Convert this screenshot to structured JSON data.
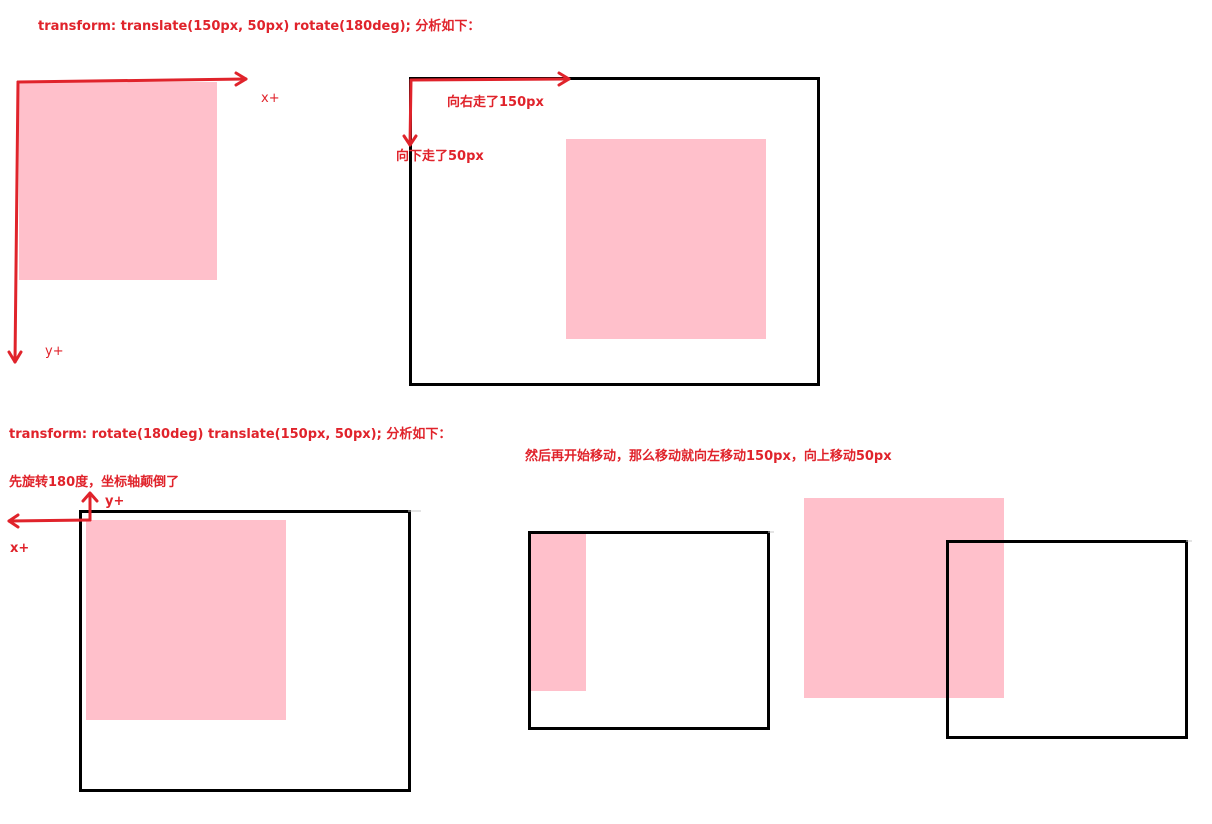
{
  "colors": {
    "annotation": "#e0232b",
    "arrow": "#e0232b",
    "pink_box": "#ffc0cb",
    "frame": "#000000",
    "background": "#ffffff"
  },
  "top_section": {
    "title": "transform: translate(150px, 50px) rotate(180deg); 分析如下：",
    "axes": {
      "x_label": "x+",
      "y_label": "y+"
    },
    "move_right_label": "向右走了150px",
    "move_down_label": "向下走了50px"
  },
  "bottom_section": {
    "title": "transform: rotate(180deg) translate(150px, 50px); 分析如下：",
    "rotate_first_label": "先旋转180度，坐标轴颠倒了",
    "axes": {
      "x_label": "x+",
      "y_label": "y+"
    },
    "move_note": "然后再开始移动，那么移动就向左移动150px，向上移动50px"
  }
}
